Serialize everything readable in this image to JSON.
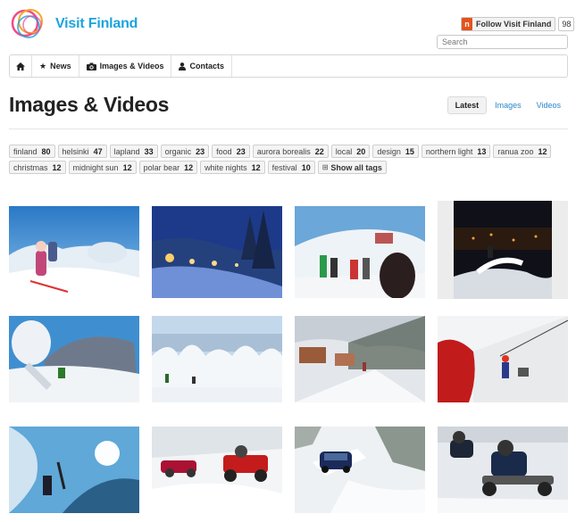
{
  "header": {
    "brand": "Visit Finland",
    "follow_label": "Follow Visit Finland",
    "follow_count": "98",
    "search_placeholder": "Search"
  },
  "nav": {
    "items": [
      {
        "label": "News",
        "icon": "star-icon"
      },
      {
        "label": "Images & Videos",
        "icon": "camera-icon"
      },
      {
        "label": "Contacts",
        "icon": "user-icon"
      }
    ]
  },
  "page": {
    "title": "Images & Videos",
    "filters": [
      "Latest",
      "Images",
      "Videos"
    ],
    "active_filter": "Latest"
  },
  "tags": [
    {
      "name": "finland",
      "count": "80"
    },
    {
      "name": "helsinki",
      "count": "47"
    },
    {
      "name": "lapland",
      "count": "33"
    },
    {
      "name": "organic",
      "count": "23"
    },
    {
      "name": "food",
      "count": "23"
    },
    {
      "name": "aurora borealis",
      "count": "22"
    },
    {
      "name": "local",
      "count": "20"
    },
    {
      "name": "design",
      "count": "15"
    },
    {
      "name": "northern light",
      "count": "13"
    },
    {
      "name": "ranua zoo",
      "count": "12"
    },
    {
      "name": "christmas",
      "count": "12"
    },
    {
      "name": "midnight sun",
      "count": "12"
    },
    {
      "name": "polar bear",
      "count": "12"
    },
    {
      "name": "white nights",
      "count": "12"
    },
    {
      "name": "festival",
      "count": "10"
    }
  ],
  "show_all_tags": "Show all tags",
  "colors": {
    "brand_blue": "#1ba3de",
    "link_blue": "#2a87c9",
    "follow_orange": "#e3531d"
  }
}
